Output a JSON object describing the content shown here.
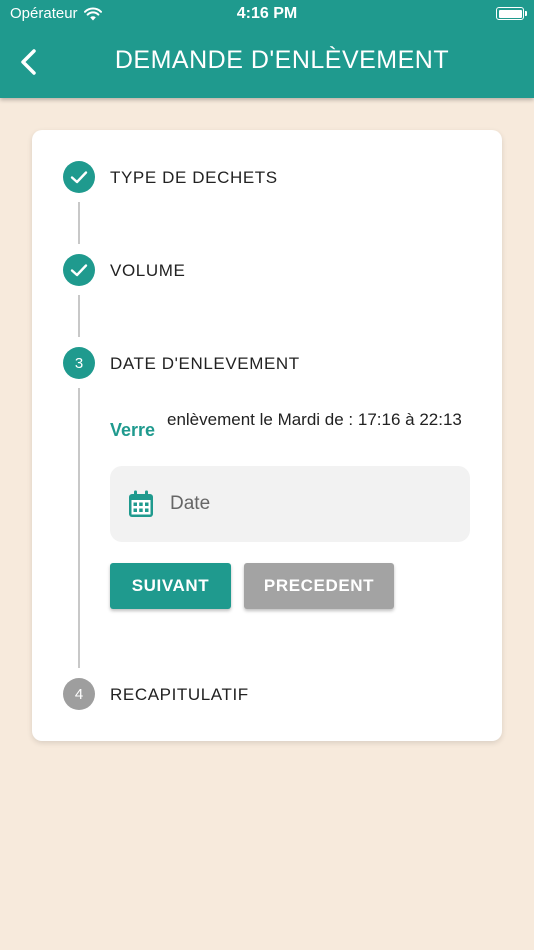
{
  "status_bar": {
    "carrier": "Opérateur",
    "time": "4:16 PM"
  },
  "header": {
    "title": "DEMANDE D'ENLÈVEMENT"
  },
  "steps": [
    {
      "label": "TYPE DE DECHETS",
      "state": "done"
    },
    {
      "label": "VOLUME",
      "state": "done"
    },
    {
      "label": "DATE D'ENLEVEMENT",
      "state": "active",
      "number": "3"
    },
    {
      "label": "RECAPITULATIF",
      "state": "pending",
      "number": "4"
    }
  ],
  "active_step": {
    "category": "Verre",
    "pickup_info": "enlèvement le Mardi de : 17:16 à 22:13",
    "date_placeholder": "Date",
    "next_label": "SUIVANT",
    "previous_label": "PRECEDENT"
  },
  "colors": {
    "accent": "#1f9a8e",
    "background": "#f7eadc",
    "pending": "#9e9e9e",
    "disabled_button": "#a3a3a3"
  }
}
